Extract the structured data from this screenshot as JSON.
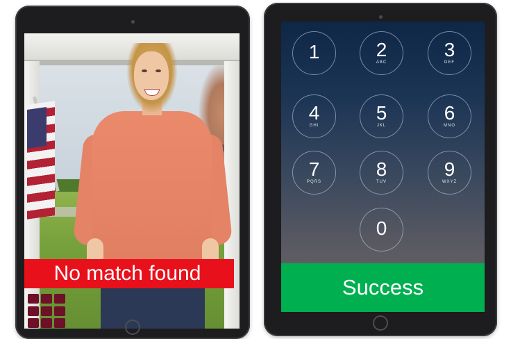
{
  "left_panel": {
    "status_text": "No match found",
    "status_color": "#e8101b",
    "logo": "maroon-grid-logo"
  },
  "right_panel": {
    "keypad": [
      {
        "digit": "1",
        "letters": ""
      },
      {
        "digit": "2",
        "letters": "ABC"
      },
      {
        "digit": "3",
        "letters": "DEF"
      },
      {
        "digit": "4",
        "letters": "GHI"
      },
      {
        "digit": "5",
        "letters": "JKL"
      },
      {
        "digit": "6",
        "letters": "MNO"
      },
      {
        "digit": "7",
        "letters": "PQRS"
      },
      {
        "digit": "8",
        "letters": "TUV"
      },
      {
        "digit": "9",
        "letters": "WXYZ"
      },
      {
        "digit": "0",
        "letters": ""
      }
    ],
    "status_text": "Success",
    "status_color": "#00b050"
  }
}
